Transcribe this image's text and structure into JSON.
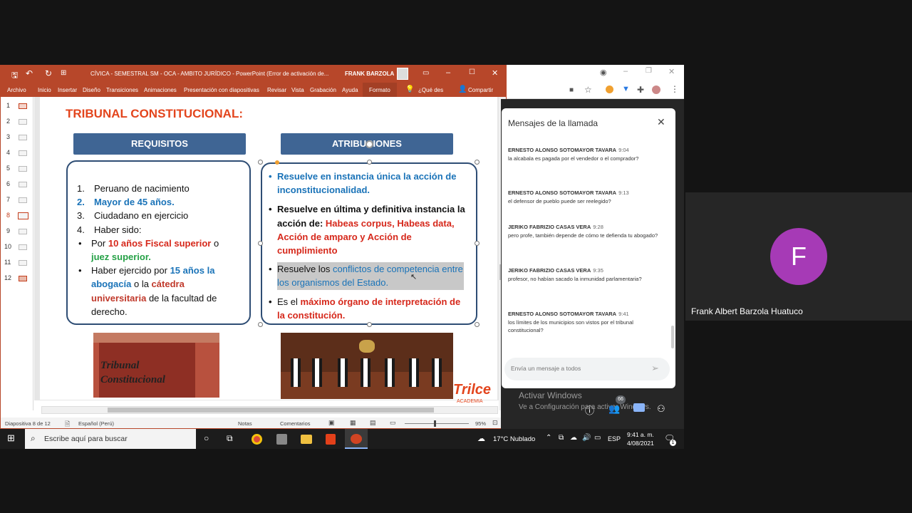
{
  "ppt": {
    "title": "CÍVICA - SEMESTRAL SM - OCA - AMBITO JURÍDICO  -  PowerPoint (Error de activación de...",
    "user": "FRANK BARZOLA",
    "menu": [
      "Archivo",
      "Inicio",
      "Insertar",
      "Diseño",
      "Transiciones",
      "Animaciones",
      "Presentación con diapositivas",
      "Revisar",
      "Vista",
      "Grabación",
      "Ayuda",
      "Formato",
      "¿Qué des",
      "Compartir"
    ],
    "thumbs": [
      "1",
      "2",
      "3",
      "4",
      "5",
      "6",
      "7",
      "8",
      "9",
      "10",
      "11",
      "12"
    ],
    "status_slide": "Diapositiva 8 de 12",
    "status_lang": "Español (Perú)",
    "status_notes": "Notas",
    "status_comments": "Comentarios",
    "zoom": "95%"
  },
  "slide": {
    "title": "TRIBUNAL CONSTITUCIONAL:",
    "left_header": "REQUISITOS",
    "right_header": "ATRIBUCIONES",
    "req": {
      "i1n": "1.",
      "i1": "Peruano de nacimiento",
      "i2n": "2.",
      "i2": "Mayor de 45 años.",
      "i3n": "3.",
      "i3": "Ciudadano en ejercicio",
      "i4n": "4.",
      "i4": "Haber sido:",
      "b1a": "Por ",
      "b1b": "10 años Fiscal superior",
      "b1c": " o",
      "b1d": "juez superior.",
      "b2a": "Haber ejercido por ",
      "b2b": "15 años la abogacía",
      "b2c": " o la ",
      "b2d": "cátedra universitaria",
      "b2e": " de la facultad de derecho."
    },
    "atr": {
      "a1": "Resuelve en instancia única la acción de inconstitucionalidad.",
      "a2a": "Resuelve en última y definitiva instancia la acción de: ",
      "a2b": "Habeas corpus, Habeas data, Acción de amparo y Acción de cumplimiento",
      "a3a": "Resuelve los ",
      "a3b": "conflictos de competencia entre los organismos del Estado.",
      "a4a": "Es el ",
      "a4b": "máximo órgano de interpretación de la constitución."
    },
    "img1_text": "Tribunal Constitucional",
    "logo_text": "Trilce",
    "logo_sub": "ACADEMIA"
  },
  "meet": {
    "panel_title": "Mensajes de la llamada",
    "messages": [
      {
        "name": "ERNESTO ALONSO SOTOMAYOR TAVARA",
        "time": "9:04",
        "text": "la alcabala es pagada por el vendedor o el comprador?"
      },
      {
        "name": "ERNESTO ALONSO SOTOMAYOR TAVARA",
        "time": "9:13",
        "text": "el defensor de pueblo puede ser reelegido?"
      },
      {
        "name": "JERIKO FABRIZIO CASAS VERA",
        "time": "9:28",
        "text": "pero profe, también depende de cómo te defienda tu abogado?"
      },
      {
        "name": "JERIKO FABRIZIO CASAS VERA",
        "time": "9:35",
        "text": "profesor, no habían sacado la inmunidad parlamentaria?"
      },
      {
        "name": "ERNESTO ALONSO SOTOMAYOR TAVARA",
        "time": "9:41",
        "text": "los límites de los municipios son vistos por el tribunal constitucional?"
      }
    ],
    "input_placeholder": "Envía un mensaje a todos",
    "activate_title": "Activar Windows",
    "activate_sub": "Ve a Configuración para activar Windows.",
    "participants_count": "66",
    "participant_initial": "F",
    "participant_name": "Frank Albert Barzola Huatuco",
    "avatar_color": "#a63ab6"
  },
  "taskbar": {
    "search": "Escribe aquí para buscar",
    "weather": "17°C  Nublado",
    "lang": "ESP",
    "time": "9:41 a. m.",
    "date": "4/08/2021",
    "notif": "1"
  }
}
